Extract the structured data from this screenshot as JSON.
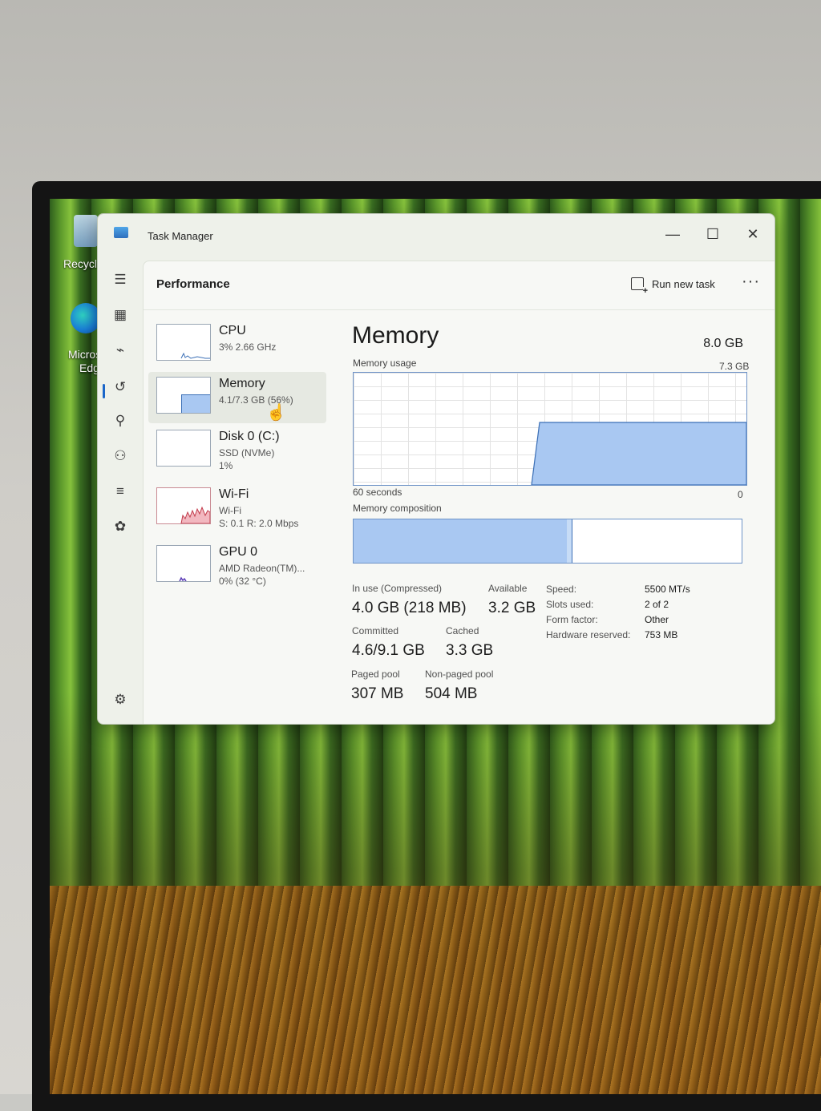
{
  "desktop": {
    "icons": [
      {
        "label": "Recycle",
        "name": "recycle-bin-icon"
      },
      {
        "label": "Micros",
        "label2": "Edg",
        "name": "edge-icon"
      }
    ]
  },
  "window": {
    "title": "Task Manager",
    "controls": {
      "minimize": "—",
      "maximize": "☐",
      "close": "✕"
    }
  },
  "nav": {
    "items": [
      "menu-icon",
      "processes-icon",
      "performance-icon",
      "app-history-icon",
      "startup-apps-icon",
      "users-icon",
      "details-icon",
      "services-icon",
      "settings-icon"
    ],
    "active": "performance-icon"
  },
  "header": {
    "title": "Performance",
    "run_new_task": "Run new task",
    "more": "···"
  },
  "resources": [
    {
      "name": "CPU",
      "line1": "3% 2.66 GHz",
      "line2": "",
      "selected": false,
      "color": "#3b6fb6"
    },
    {
      "name": "Memory",
      "line1": "4.1/7.3 GB (56%)",
      "line2": "",
      "selected": true,
      "color": "#3b6fb6"
    },
    {
      "name": "Disk 0 (C:)",
      "line1": "SSD (NVMe)",
      "line2": "1%",
      "selected": false,
      "color": "#3a8a3a"
    },
    {
      "name": "Wi-Fi",
      "line1": "Wi-Fi",
      "line2": "S: 0.1 R: 2.0 Mbps",
      "selected": false,
      "color": "#c23b4b"
    },
    {
      "name": "GPU 0",
      "line1": "AMD Radeon(TM)...",
      "line2": "0% (32 °C)",
      "selected": false,
      "color": "#5a3bb6"
    }
  ],
  "memory": {
    "title": "Memory",
    "total": "8.0 GB",
    "usage_label": "Memory usage",
    "usage_max": "7.3 GB",
    "time_label": "60 seconds",
    "time_end": "0",
    "composition_label": "Memory composition",
    "composition_in_use_fraction": 0.55,
    "stats": {
      "in_use_label": "In use (Compressed)",
      "in_use_value": "4.0 GB (218 MB)",
      "available_label": "Available",
      "available_value": "3.2 GB",
      "committed_label": "Committed",
      "committed_value": "4.6/9.1 GB",
      "cached_label": "Cached",
      "cached_value": "3.3 GB",
      "paged_label": "Paged pool",
      "paged_value": "307 MB",
      "nonpaged_label": "Non-paged pool",
      "nonpaged_value": "504 MB"
    },
    "specs": [
      {
        "label": "Speed:",
        "value": "5500 MT/s"
      },
      {
        "label": "Slots used:",
        "value": "2 of 2"
      },
      {
        "label": "Form factor:",
        "value": "Other"
      },
      {
        "label": "Hardware reserved:",
        "value": "753 MB"
      }
    ]
  },
  "colors": {
    "accent": "#1a66c9",
    "graph_fill": "#a9c8f2",
    "graph_line": "#6e93c7"
  }
}
